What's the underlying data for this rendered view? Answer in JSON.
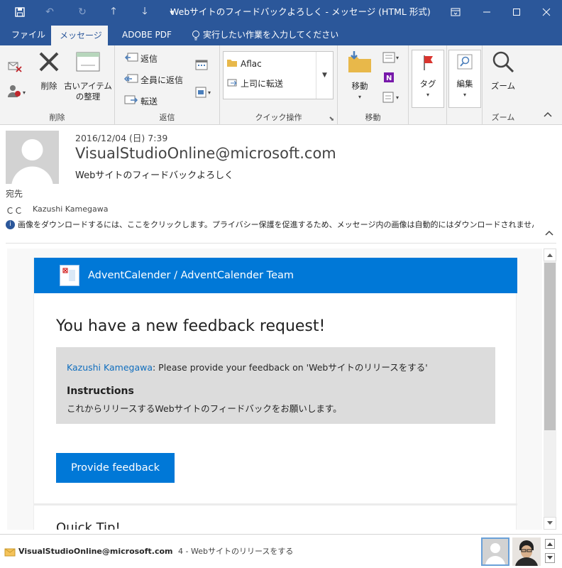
{
  "window": {
    "title": "Webサイトのフィードバックよろしく - メッセージ (HTML 形式)"
  },
  "tabs": [
    {
      "label": "ファイル"
    },
    {
      "label": "メッセージ"
    },
    {
      "label": "ADOBE PDF"
    },
    {
      "label": "実行したい作業を入力してください"
    }
  ],
  "ribbon": {
    "delete_group": {
      "label": "削除",
      "delete": "削除",
      "cleanup_line1": "古いアイテム",
      "cleanup_line2": "の整理"
    },
    "reply_group": {
      "label": "返信",
      "reply": "返信",
      "reply_all": "全員に返信",
      "forward": "転送"
    },
    "quick_steps": {
      "label": "クイック操作",
      "item1": "Aflac",
      "item2": "上司に転送"
    },
    "move_group": {
      "label": "移動",
      "move": "移動"
    },
    "tags_group": {
      "tag": "タグ"
    },
    "edit_group": {
      "edit": "編集"
    },
    "zoom_group": {
      "label": "ズーム",
      "zoom": "ズーム"
    }
  },
  "message": {
    "date": "2016/12/04 (日) 7:39",
    "sender": "VisualStudioOnline@microsoft.com",
    "subject": "Webサイトのフィードバックよろしく",
    "to_label": "宛先",
    "cc_label": "ＣＣ",
    "cc_value": "Kazushi Kamegawa",
    "info_bar": "画像をダウンロードするには、ここをクリックします。プライバシー保護を促進するため、メッセージ内の画像は自動的にはダウンロードされません。"
  },
  "email_body": {
    "banner_title": "AdventCalender / AdventCalender Team",
    "headline": "You have a new feedback request!",
    "requester": "Kazushi Kamegawa",
    "request_text": ": Please provide your feedback on 'Webサイトのリリースをする'",
    "instructions_title": "Instructions",
    "instructions_text": "これからリリースするWebサイトのフィードバックをお願いします。",
    "button_label": "Provide feedback",
    "quick_tip": "Quick Tip!"
  },
  "statusbar": {
    "sender": "VisualStudioOnline@microsoft.com",
    "detail": "4 - Webサイトのリリースをする"
  },
  "colors": {
    "titlebar": "#2b579a",
    "ribbon": "#f3f3f3",
    "banner": "#0078d7",
    "link": "#106ebe",
    "button": "#0078d7"
  }
}
